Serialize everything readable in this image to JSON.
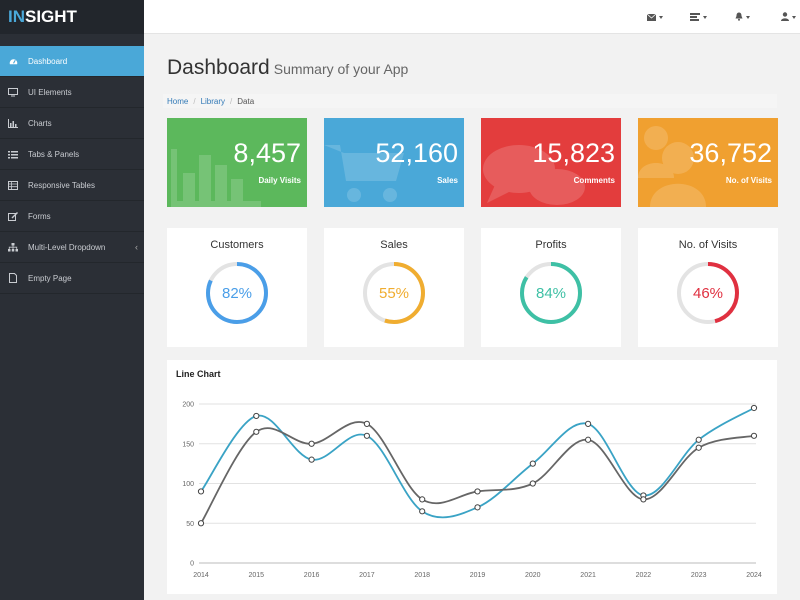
{
  "brand": {
    "prefix": "IN",
    "suffix": "SIGHT"
  },
  "sidebar": {
    "items": [
      {
        "label": "Dashboard",
        "icon": "dashboard-icon",
        "active": true
      },
      {
        "label": "UI Elements",
        "icon": "desktop-icon"
      },
      {
        "label": "Charts",
        "icon": "bar-chart-icon"
      },
      {
        "label": "Tabs & Panels",
        "icon": "list-icon"
      },
      {
        "label": "Responsive Tables",
        "icon": "table-icon"
      },
      {
        "label": "Forms",
        "icon": "edit-icon"
      },
      {
        "label": "Multi-Level Dropdown",
        "icon": "sitemap-icon",
        "chevron": "‹"
      },
      {
        "label": "Empty Page",
        "icon": "file-icon"
      }
    ]
  },
  "topbar": {
    "icons": [
      "envelope-icon",
      "tasks-icon",
      "bell-icon",
      "user-icon"
    ]
  },
  "header": {
    "title": "Dashboard",
    "subtitle": "Summary of your App"
  },
  "breadcrumb": {
    "items": [
      "Home",
      "Library"
    ],
    "current": "Data",
    "separator": "/"
  },
  "stats": [
    {
      "value": "8,457",
      "label": "Daily Visits",
      "color": "#5cb85c",
      "icon": "bar-chart-icon"
    },
    {
      "value": "52,160",
      "label": "Sales",
      "color": "#4aa8d8",
      "icon": "shopping-cart-icon"
    },
    {
      "value": "15,823",
      "label": "Comments",
      "color": "#e33d3d",
      "icon": "comments-icon"
    },
    {
      "value": "36,752",
      "label": "No. of Visits",
      "color": "#f0a030",
      "icon": "users-icon"
    }
  ],
  "donuts": [
    {
      "title": "Customers",
      "percent": 82,
      "label": "82%",
      "color": "#4a9ee8"
    },
    {
      "title": "Sales",
      "percent": 55,
      "label": "55%",
      "color": "#f0ad30"
    },
    {
      "title": "Profits",
      "percent": 84,
      "label": "84%",
      "color": "#3ec0a5"
    },
    {
      "title": "No. of Visits",
      "percent": 46,
      "label": "46%",
      "color": "#e03040"
    }
  ],
  "chart_data": {
    "type": "line",
    "title": "Line Chart",
    "x": [
      "2014",
      "2015",
      "2016",
      "2017",
      "2018",
      "2019",
      "2020",
      "2021",
      "2022",
      "2023",
      "2024"
    ],
    "ylim": [
      0,
      200
    ],
    "yticks": [
      "0",
      "50",
      "100",
      "150",
      "200"
    ],
    "grid": true,
    "series": [
      {
        "values": [
          90,
          185,
          130,
          160,
          65,
          70,
          125,
          175,
          85,
          155,
          195
        ],
        "color": "#3aa3c5"
      },
      {
        "values": [
          50,
          165,
          150,
          175,
          80,
          90,
          100,
          155,
          80,
          145,
          160
        ],
        "color": "#666666"
      }
    ]
  }
}
